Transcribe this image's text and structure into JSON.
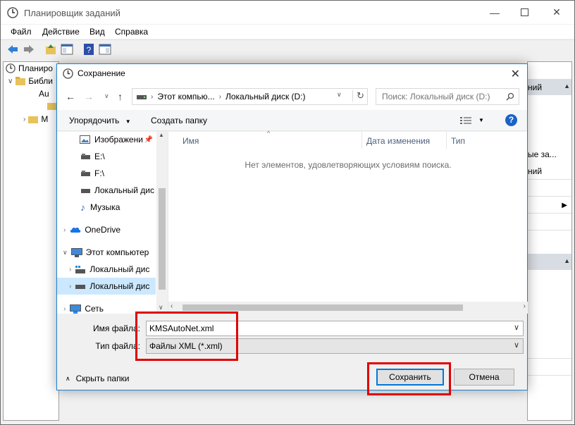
{
  "main_window": {
    "title": "Планировщик заданий",
    "menu": [
      "Файл",
      "Действие",
      "Вид",
      "Справка"
    ],
    "tree": [
      "Планиро",
      "Библи",
      "Au",
      "",
      "M"
    ],
    "right_pane": {
      "header1": "ний",
      "lines": [
        "ые за...",
        "ний"
      ],
      "arrow": "▶"
    }
  },
  "dialog": {
    "title": "Сохранение",
    "address": {
      "part1": "Этот компью...",
      "part2": "Локальный диск (D:)"
    },
    "search_placeholder": "Поиск: Локальный диск (D:)",
    "commands": {
      "organize": "Упорядочить",
      "new_folder": "Создать папку"
    },
    "nav_items": [
      {
        "label": "Изображени",
        "icon": "pictures-icon"
      },
      {
        "label": "E:\\",
        "icon": "drive-icon"
      },
      {
        "label": "F:\\",
        "icon": "drive-icon"
      },
      {
        "label": "Локальный дис",
        "icon": "drive-icon"
      },
      {
        "label": "Музыка",
        "icon": "music-icon"
      },
      {
        "label": "OneDrive",
        "icon": "onedrive-icon"
      },
      {
        "label": "Этот компьютер",
        "icon": "computer-icon"
      },
      {
        "label": "Локальный дис",
        "icon": "windows-drive-icon"
      },
      {
        "label": "Локальный дис",
        "icon": "drive-icon"
      },
      {
        "label": "Сеть",
        "icon": "network-icon"
      }
    ],
    "columns": [
      "Имя",
      "Дата изменения",
      "Тип"
    ],
    "empty_message": "Нет элементов, удовлетворяющих условиям поиска.",
    "filename_label": "Имя файла:",
    "filename_value": "KMSAutoNet.xml",
    "filetype_label": "Тип файла:",
    "filetype_value": "Файлы XML (*.xml)",
    "hide_folders": "Скрыть папки",
    "save_button": "Сохранить",
    "cancel_button": "Отмена"
  },
  "colors": {
    "highlight": "#e00000",
    "accent": "#0078d7"
  }
}
